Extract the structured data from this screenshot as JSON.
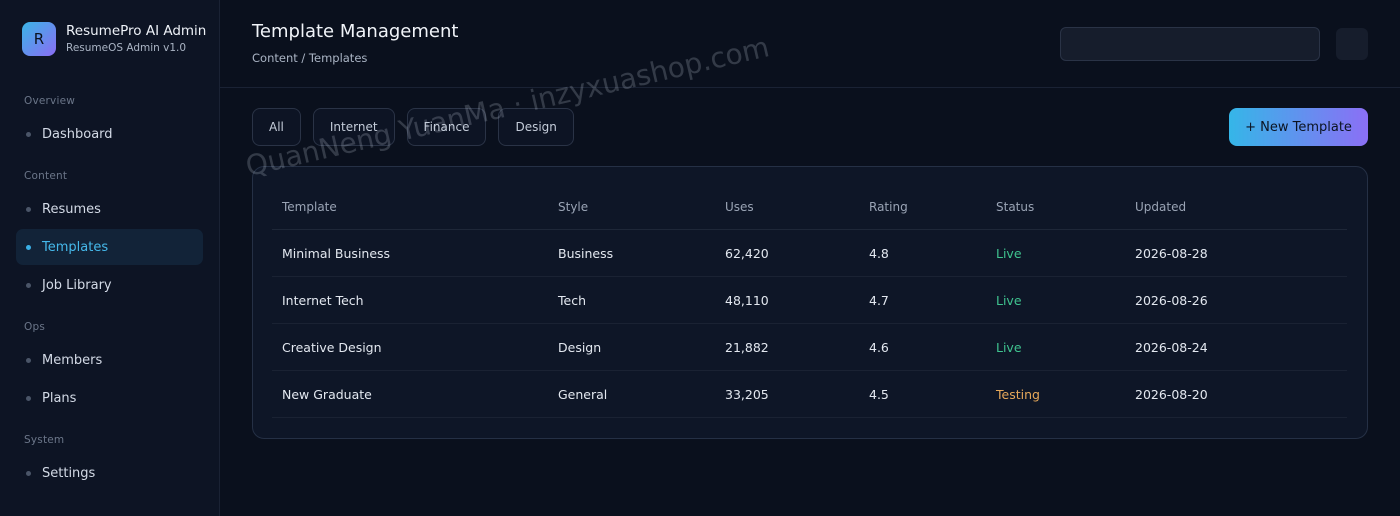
{
  "brand": {
    "logo_letter": "R",
    "name": "ResumePro AI Admin",
    "subtitle": "ResumeOS Admin v1.0"
  },
  "sidebar": {
    "sections": [
      {
        "title": "Overview",
        "items": [
          {
            "label": "Dashboard",
            "active": false
          }
        ]
      },
      {
        "title": "Content",
        "items": [
          {
            "label": "Resumes",
            "active": false
          },
          {
            "label": "Templates",
            "active": true
          },
          {
            "label": "Job Library",
            "active": false
          }
        ]
      },
      {
        "title": "Ops",
        "items": [
          {
            "label": "Members",
            "active": false
          },
          {
            "label": "Plans",
            "active": false
          }
        ]
      },
      {
        "title": "System",
        "items": [
          {
            "label": "Settings",
            "active": false
          }
        ]
      }
    ]
  },
  "header": {
    "title": "Template Management",
    "breadcrumb": "Content / Templates",
    "search_value": ""
  },
  "filters": [
    "All",
    "Internet",
    "Finance",
    "Design"
  ],
  "actions": {
    "new_template_label": "+ New Template"
  },
  "table": {
    "columns": [
      "Template",
      "Style",
      "Uses",
      "Rating",
      "Status",
      "Updated"
    ],
    "rows": [
      [
        "Minimal Business",
        "Business",
        "62,420",
        "4.8",
        "Live",
        "2026-08-28"
      ],
      [
        "Internet Tech",
        "Tech",
        "48,110",
        "4.7",
        "Live",
        "2026-08-26"
      ],
      [
        "Creative Design",
        "Design",
        "21,882",
        "4.6",
        "Live",
        "2026-08-24"
      ],
      [
        "New Graduate",
        "General",
        "33,205",
        "4.5",
        "Testing",
        "2026-08-20"
      ]
    ]
  },
  "status_colors": {
    "Live": "#3fc38f",
    "Testing": "#e6a85a"
  },
  "colors": {
    "accent": "#3ab0e6",
    "accent_gradient_end": "#8b6ff5"
  },
  "watermark": "QuanNeng YuanMa · inzyxuashop.com"
}
